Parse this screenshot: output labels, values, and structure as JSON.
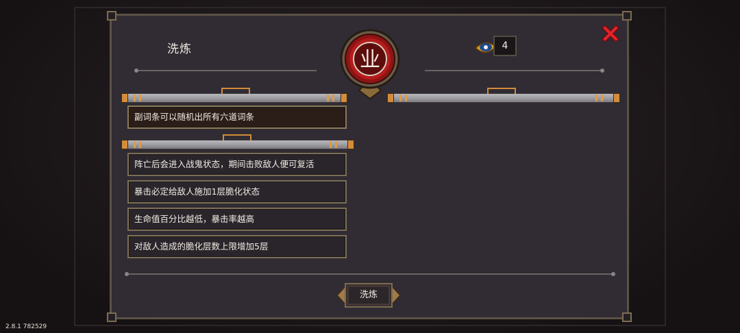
{
  "dialog": {
    "title": "洗炼",
    "emblem_glyph": "业",
    "currency": {
      "icon": "eye-gem-icon",
      "count": "4"
    },
    "close_icon": "close-x-icon"
  },
  "primary_trait": {
    "text": "副词条可以随机出所有六道词条"
  },
  "secondary_traits": [
    {
      "text": "阵亡后会进入战鬼状态，期间击败敌人便可复活"
    },
    {
      "text": "暴击必定给敌人施加1层脆化状态"
    },
    {
      "text": "生命值百分比越低，暴击率越高"
    },
    {
      "text": "对敌人造成的脆化层数上限增加5层"
    }
  ],
  "wash_button": {
    "label": "洗炼"
  },
  "version_text": "2.8.1 782529",
  "colors": {
    "accent_orange": "#d58c3a",
    "close_red": "#e0242a",
    "emblem_red": "#b51c1c",
    "panel_bg": "#312c33"
  }
}
